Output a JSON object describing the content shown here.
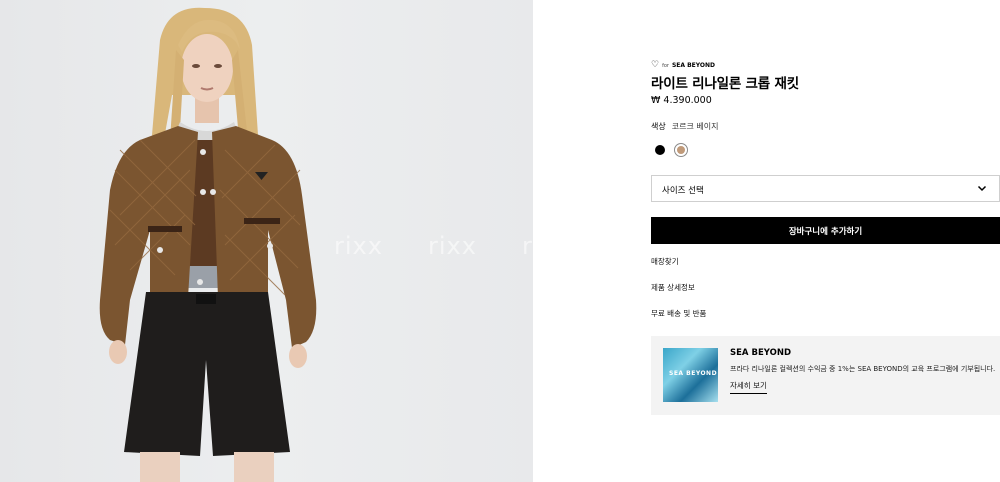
{
  "gallery": {
    "watermark_text": "rixx",
    "watermark_partial_1": "r",
    "watermark_partial_2": "x"
  },
  "product": {
    "collection_tag": "SEA BEYOND",
    "collection_for": "for",
    "title": "라이트 리나일론 크롭 재킷",
    "price": "₩ 4.390.000",
    "color_label": "색상",
    "color_value": "코르크 베이지",
    "swatches": [
      {
        "name": "black",
        "color": "#000000"
      },
      {
        "name": "cork-beige",
        "color": "#c09a7a",
        "selected": true
      }
    ],
    "size_select": {
      "placeholder": "사이즈 선택"
    },
    "add_to_cart": "장바구니에 추가하기",
    "links": [
      "매장찾기",
      "제품 상세정보",
      "무료 배송 및 반품"
    ]
  },
  "promo": {
    "thumb_text": "SEA BEYOND",
    "title": "SEA BEYOND",
    "description": "프라다 리나일론 컬렉션의 수익금 중 1%는 SEA BEYOND의 교육 프로그램에 기부됩니다.",
    "link": "자세히 보기"
  },
  "colors": {
    "jacket": "#7b5530",
    "shorts": "#1f1d1c",
    "button_black": "#000000"
  }
}
